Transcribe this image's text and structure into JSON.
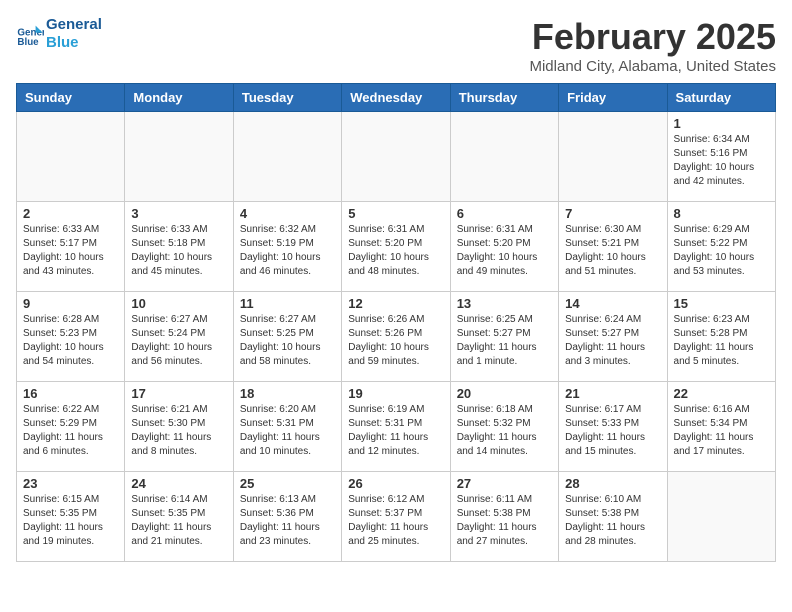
{
  "logo": {
    "line1": "General",
    "line2": "Blue"
  },
  "title": "February 2025",
  "location": "Midland City, Alabama, United States",
  "days_of_week": [
    "Sunday",
    "Monday",
    "Tuesday",
    "Wednesday",
    "Thursday",
    "Friday",
    "Saturday"
  ],
  "weeks": [
    [
      {
        "day": "",
        "info": ""
      },
      {
        "day": "",
        "info": ""
      },
      {
        "day": "",
        "info": ""
      },
      {
        "day": "",
        "info": ""
      },
      {
        "day": "",
        "info": ""
      },
      {
        "day": "",
        "info": ""
      },
      {
        "day": "1",
        "info": "Sunrise: 6:34 AM\nSunset: 5:16 PM\nDaylight: 10 hours and 42 minutes."
      }
    ],
    [
      {
        "day": "2",
        "info": "Sunrise: 6:33 AM\nSunset: 5:17 PM\nDaylight: 10 hours and 43 minutes."
      },
      {
        "day": "3",
        "info": "Sunrise: 6:33 AM\nSunset: 5:18 PM\nDaylight: 10 hours and 45 minutes."
      },
      {
        "day": "4",
        "info": "Sunrise: 6:32 AM\nSunset: 5:19 PM\nDaylight: 10 hours and 46 minutes."
      },
      {
        "day": "5",
        "info": "Sunrise: 6:31 AM\nSunset: 5:20 PM\nDaylight: 10 hours and 48 minutes."
      },
      {
        "day": "6",
        "info": "Sunrise: 6:31 AM\nSunset: 5:20 PM\nDaylight: 10 hours and 49 minutes."
      },
      {
        "day": "7",
        "info": "Sunrise: 6:30 AM\nSunset: 5:21 PM\nDaylight: 10 hours and 51 minutes."
      },
      {
        "day": "8",
        "info": "Sunrise: 6:29 AM\nSunset: 5:22 PM\nDaylight: 10 hours and 53 minutes."
      }
    ],
    [
      {
        "day": "9",
        "info": "Sunrise: 6:28 AM\nSunset: 5:23 PM\nDaylight: 10 hours and 54 minutes."
      },
      {
        "day": "10",
        "info": "Sunrise: 6:27 AM\nSunset: 5:24 PM\nDaylight: 10 hours and 56 minutes."
      },
      {
        "day": "11",
        "info": "Sunrise: 6:27 AM\nSunset: 5:25 PM\nDaylight: 10 hours and 58 minutes."
      },
      {
        "day": "12",
        "info": "Sunrise: 6:26 AM\nSunset: 5:26 PM\nDaylight: 10 hours and 59 minutes."
      },
      {
        "day": "13",
        "info": "Sunrise: 6:25 AM\nSunset: 5:27 PM\nDaylight: 11 hours and 1 minute."
      },
      {
        "day": "14",
        "info": "Sunrise: 6:24 AM\nSunset: 5:27 PM\nDaylight: 11 hours and 3 minutes."
      },
      {
        "day": "15",
        "info": "Sunrise: 6:23 AM\nSunset: 5:28 PM\nDaylight: 11 hours and 5 minutes."
      }
    ],
    [
      {
        "day": "16",
        "info": "Sunrise: 6:22 AM\nSunset: 5:29 PM\nDaylight: 11 hours and 6 minutes."
      },
      {
        "day": "17",
        "info": "Sunrise: 6:21 AM\nSunset: 5:30 PM\nDaylight: 11 hours and 8 minutes."
      },
      {
        "day": "18",
        "info": "Sunrise: 6:20 AM\nSunset: 5:31 PM\nDaylight: 11 hours and 10 minutes."
      },
      {
        "day": "19",
        "info": "Sunrise: 6:19 AM\nSunset: 5:31 PM\nDaylight: 11 hours and 12 minutes."
      },
      {
        "day": "20",
        "info": "Sunrise: 6:18 AM\nSunset: 5:32 PM\nDaylight: 11 hours and 14 minutes."
      },
      {
        "day": "21",
        "info": "Sunrise: 6:17 AM\nSunset: 5:33 PM\nDaylight: 11 hours and 15 minutes."
      },
      {
        "day": "22",
        "info": "Sunrise: 6:16 AM\nSunset: 5:34 PM\nDaylight: 11 hours and 17 minutes."
      }
    ],
    [
      {
        "day": "23",
        "info": "Sunrise: 6:15 AM\nSunset: 5:35 PM\nDaylight: 11 hours and 19 minutes."
      },
      {
        "day": "24",
        "info": "Sunrise: 6:14 AM\nSunset: 5:35 PM\nDaylight: 11 hours and 21 minutes."
      },
      {
        "day": "25",
        "info": "Sunrise: 6:13 AM\nSunset: 5:36 PM\nDaylight: 11 hours and 23 minutes."
      },
      {
        "day": "26",
        "info": "Sunrise: 6:12 AM\nSunset: 5:37 PM\nDaylight: 11 hours and 25 minutes."
      },
      {
        "day": "27",
        "info": "Sunrise: 6:11 AM\nSunset: 5:38 PM\nDaylight: 11 hours and 27 minutes."
      },
      {
        "day": "28",
        "info": "Sunrise: 6:10 AM\nSunset: 5:38 PM\nDaylight: 11 hours and 28 minutes."
      },
      {
        "day": "",
        "info": ""
      }
    ]
  ]
}
